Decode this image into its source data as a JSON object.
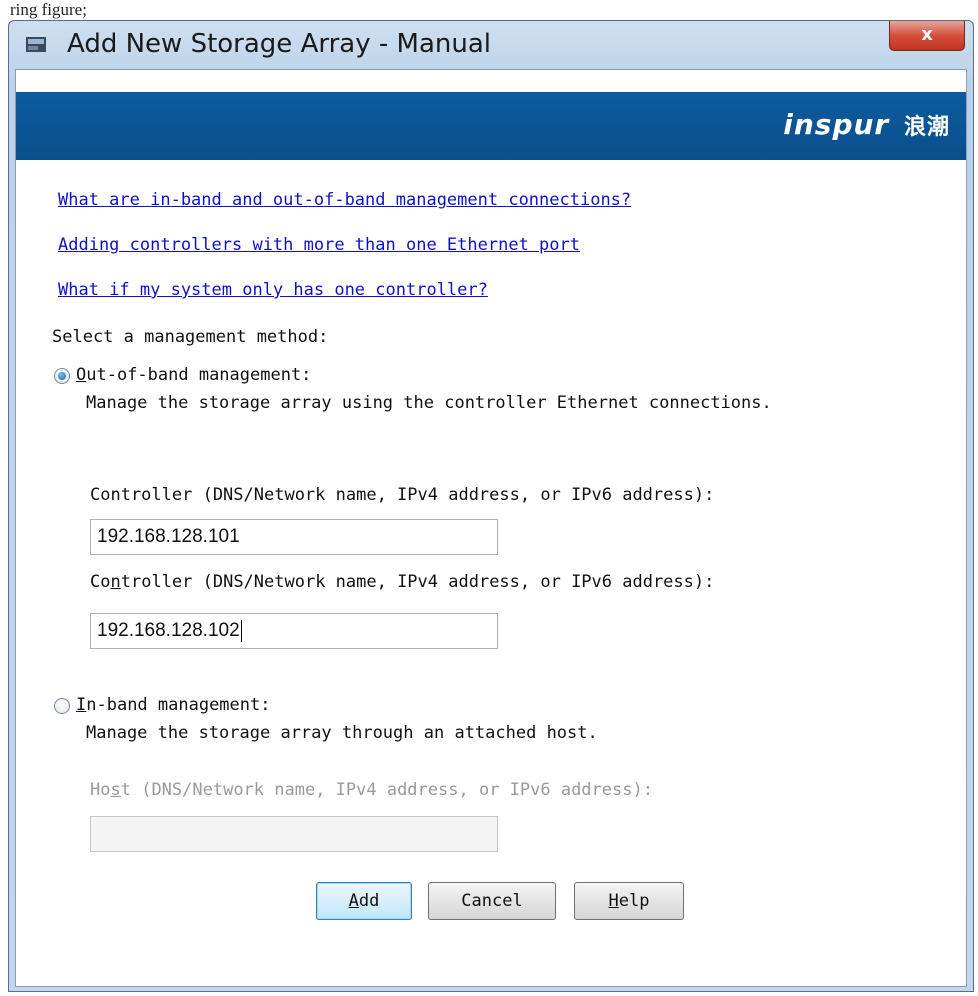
{
  "caption": "ring figure;",
  "window": {
    "title": "Add New Storage Array - Manual",
    "close_label": "x"
  },
  "banner": {
    "brand": "inspur",
    "brand_cn": "浪潮",
    "color": "#0a4f8c"
  },
  "links": [
    "What are in-band and out-of-band management connections?",
    "Adding controllers with more than one Ethernet port",
    "What if my system only has one controller?"
  ],
  "method_prompt": "Select a management method:",
  "out_of_band": {
    "selected": true,
    "label_mn": "O",
    "label_rest": "ut-of-band management:",
    "description": "Manage the storage array using the controller Ethernet connections.",
    "controller1_label": "Controller (DNS/Network name, IPv4 address, or IPv6 address):",
    "controller1_value": "192.168.128.101",
    "controller2_label_pre": "Co",
    "controller2_label_mn": "n",
    "controller2_label_post": "troller (DNS/Network name, IPv4 address, or IPv6 address):",
    "controller2_value": "192.168.128.102"
  },
  "in_band": {
    "selected": false,
    "label_mn": "I",
    "label_rest": "n-band management:",
    "description": "Manage the storage array through an attached host.",
    "host_label_pre": "Ho",
    "host_label_mn": "s",
    "host_label_post": "t (DNS/Network name, IPv4 address, or IPv6 address):",
    "host_value": ""
  },
  "buttons": {
    "add_mn": "A",
    "add_rest": "dd",
    "cancel": "Cancel",
    "help_mn": "H",
    "help_rest": "elp"
  }
}
